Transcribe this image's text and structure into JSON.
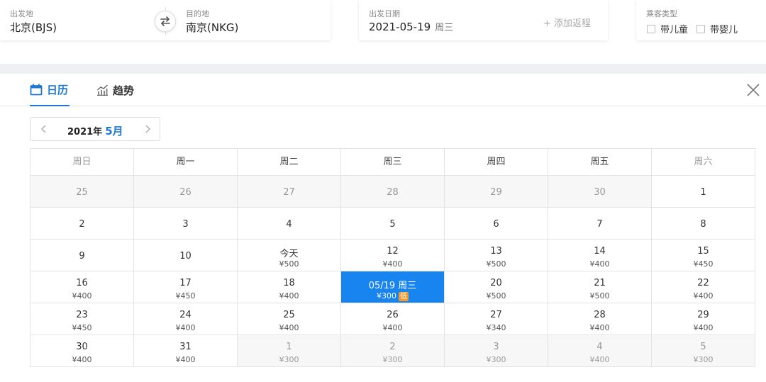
{
  "search": {
    "from": {
      "label": "出发地",
      "value": "北京(BJS)"
    },
    "to": {
      "label": "目的地",
      "value": "南京(NKG)"
    },
    "date": {
      "label": "出发日期",
      "value": "2021-05-19",
      "weekday": "周三",
      "add_return": "+ 添加返程"
    },
    "passenger": {
      "label": "乘客类型",
      "child": "带儿童",
      "infant": "带婴儿"
    }
  },
  "tabs": {
    "calendar": "日历",
    "trend": "趋势"
  },
  "nav": {
    "year": "2021年",
    "month": "5月"
  },
  "weekdays": [
    "周日",
    "周一",
    "周二",
    "周三",
    "周四",
    "周五",
    "周六"
  ],
  "colors": {
    "accent": "#1e78d2",
    "selected": "#1784f0",
    "low_tag": "#f39a2c"
  },
  "weeks": [
    [
      {
        "d": "25",
        "p": ""
      },
      {
        "d": "26",
        "p": ""
      },
      {
        "d": "27",
        "p": ""
      },
      {
        "d": "28",
        "p": ""
      },
      {
        "d": "29",
        "p": ""
      },
      {
        "d": "30",
        "p": ""
      },
      {
        "d": "1",
        "p": ""
      }
    ],
    [
      {
        "d": "2",
        "p": ""
      },
      {
        "d": "3",
        "p": ""
      },
      {
        "d": "4",
        "p": ""
      },
      {
        "d": "5",
        "p": ""
      },
      {
        "d": "6",
        "p": ""
      },
      {
        "d": "7",
        "p": ""
      },
      {
        "d": "8",
        "p": ""
      }
    ],
    [
      {
        "d": "9",
        "p": ""
      },
      {
        "d": "10",
        "p": ""
      },
      {
        "d": "今天",
        "p": "¥500"
      },
      {
        "d": "12",
        "p": "¥400"
      },
      {
        "d": "13",
        "p": "¥500"
      },
      {
        "d": "14",
        "p": "¥400"
      },
      {
        "d": "15",
        "p": "¥450"
      }
    ],
    [
      {
        "d": "16",
        "p": "¥400"
      },
      {
        "d": "17",
        "p": "¥450"
      },
      {
        "d": "18",
        "p": "¥400"
      },
      {
        "d": "05/19 周三",
        "p": "¥300",
        "tag": "低"
      },
      {
        "d": "20",
        "p": "¥500"
      },
      {
        "d": "21",
        "p": "¥500"
      },
      {
        "d": "22",
        "p": "¥400"
      }
    ],
    [
      {
        "d": "23",
        "p": "¥450"
      },
      {
        "d": "24",
        "p": "¥400"
      },
      {
        "d": "25",
        "p": "¥400"
      },
      {
        "d": "26",
        "p": "¥400"
      },
      {
        "d": "27",
        "p": "¥340"
      },
      {
        "d": "28",
        "p": "¥400"
      },
      {
        "d": "29",
        "p": "¥400"
      }
    ],
    [
      {
        "d": "30",
        "p": "¥400"
      },
      {
        "d": "31",
        "p": "¥400"
      },
      {
        "d": "1",
        "p": "¥300"
      },
      {
        "d": "2",
        "p": "¥300"
      },
      {
        "d": "3",
        "p": "¥300"
      },
      {
        "d": "4",
        "p": "¥400"
      },
      {
        "d": "5",
        "p": "¥300"
      }
    ]
  ]
}
